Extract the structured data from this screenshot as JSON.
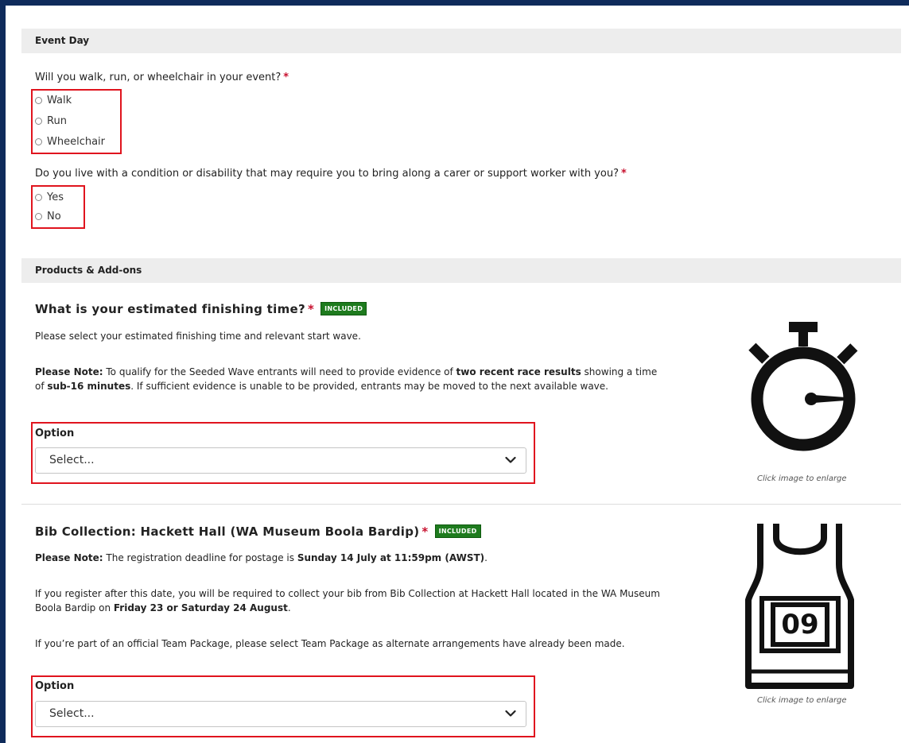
{
  "event_day": {
    "header": "Event Day",
    "question1": {
      "text": "Will you walk, run, or wheelchair in your event?",
      "required_mark": "*",
      "options": [
        "Walk",
        "Run",
        "Wheelchair"
      ]
    },
    "question2": {
      "text": "Do you live with a condition or disability that may require you to bring along a carer or support worker with you?",
      "required_mark": "*",
      "options": [
        "Yes",
        "No"
      ]
    }
  },
  "products": {
    "header": "Products & Add-ons",
    "finishing_time": {
      "title": "What is your estimated finishing time?",
      "required_mark": "*",
      "badge": "INCLUDED",
      "intro": "Please select your estimated finishing time and relevant start wave.",
      "note_label": "Please Note:",
      "note_text_1": " To qualify for the Seeded Wave entrants will need to provide evidence of ",
      "note_bold_1": "two recent race results",
      "note_text_2": " showing a time of ",
      "note_bold_2": "sub-16 minutes",
      "note_text_3": ". If sufficient evidence is unable to be provided, entrants may be moved to the next available wave.",
      "option_label": "Option",
      "select_value": "Select...",
      "image_caption": "Click image to enlarge",
      "image_icon": "stopwatch-icon"
    },
    "bib_collection": {
      "title": "Bib Collection: Hackett Hall (WA Museum Boola Bardip)",
      "required_mark": "*",
      "badge": "INCLUDED",
      "note_label": "Please Note:",
      "note_text_1": " The registration deadline for postage is ",
      "note_bold_1": "Sunday 14 July at 11:59pm (AWST)",
      "note_text_2": ".",
      "para2_text_1": "If you register after this date, you will be required to collect your bib from Bib Collection at Hackett Hall located in the WA Museum Boola Bardip on ",
      "para2_bold": "Friday 23 or Saturday 24 August",
      "para2_text_2": ".",
      "para3": "If you’re part of an official Team Package, please select Team Package as alternate arrangements have already been made.",
      "option_label": "Option",
      "select_value": "Select...",
      "image_caption": "Click image to enlarge",
      "image_icon": "race-bib-singlet-icon",
      "bib_number": "09"
    }
  },
  "colors": {
    "frame": "#0f2b5b",
    "required": "#c8102e",
    "badge": "#1e7b1e",
    "highlight": "#e0141e",
    "section_header_bg": "#ededed"
  }
}
